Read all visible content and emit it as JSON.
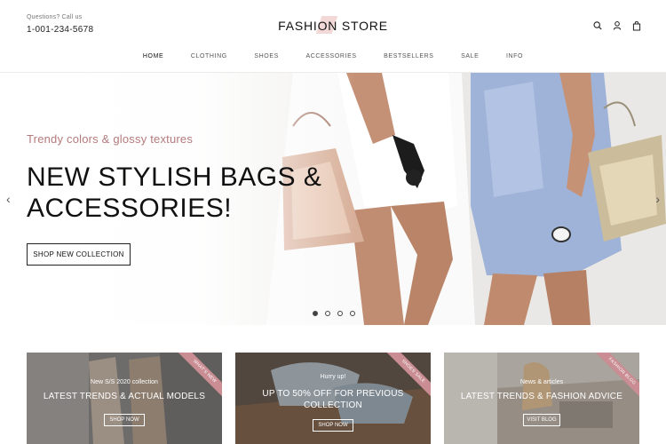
{
  "header": {
    "contact_label": "Questions? Call us",
    "phone": "1-001-234-5678",
    "brand": "FASHION STORE",
    "icons": [
      "search-icon",
      "user-icon",
      "shopping-bag-icon"
    ]
  },
  "nav": {
    "items": [
      {
        "label": "HOME",
        "active": true
      },
      {
        "label": "CLOTHING"
      },
      {
        "label": "SHOES"
      },
      {
        "label": "ACCESSORIES"
      },
      {
        "label": "BESTSELLERS"
      },
      {
        "label": "SALE"
      },
      {
        "label": "INFO"
      }
    ]
  },
  "hero": {
    "subtitle": "Trendy colors & glossy textures",
    "title": "NEW STYLISH BAGS & ACCESSORIES!",
    "button": "SHOP NEW COLLECTION",
    "slide_count": 4,
    "active_slide": 1
  },
  "cards": [
    {
      "ribbon": "WHAT'S NEW",
      "kicker": "New S/S 2020 collection",
      "headline": "LATEST TRENDS & ACTUAL MODELS",
      "button": "SHOP NOW"
    },
    {
      "ribbon": "SHOES SALE",
      "kicker": "Hurry up!",
      "headline": "UP TO 50% OFF FOR PREVIOUS COLLECTION",
      "button": "SHOP NOW"
    },
    {
      "ribbon": "FASHION BLOG",
      "kicker": "News & articles",
      "headline": "LATEST TRENDS & FASHION ADVICE",
      "button": "VISIT BLOG"
    }
  ],
  "colors": {
    "accent": "#b57a7c",
    "ribbon": "#c98d93",
    "text": "#111111"
  }
}
